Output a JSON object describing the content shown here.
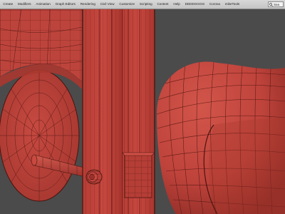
{
  "menubar": {
    "items": [
      "Create",
      "Modifiers",
      "Animation",
      "Graph Editors",
      "Rendering",
      "Civil View",
      "Customize",
      "Scripting",
      "Content",
      "Help",
      "DDDDGGGG",
      "Corona",
      "mikeTools"
    ],
    "search_label": "Sea"
  },
  "viewport": {
    "background_color": "#4b4b4b",
    "model_color": "#c0453e",
    "wire_color": "#5a1a16"
  }
}
